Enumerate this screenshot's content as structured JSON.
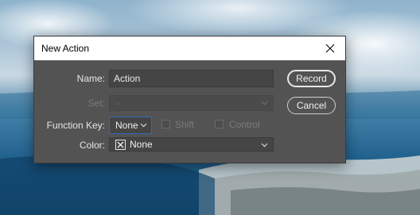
{
  "dialog": {
    "title": "New Action",
    "close_icon": "close-icon"
  },
  "form": {
    "name_label": "Name:",
    "name_value": "Action",
    "set_label": "Set:",
    "set_value": "-",
    "function_key_label": "Function Key:",
    "function_key_value": "None",
    "shift_label": "Shift",
    "control_label": "Control",
    "color_label": "Color:",
    "color_value": "None",
    "color_icon": "no-color-icon"
  },
  "buttons": {
    "record_label": "Record",
    "cancel_label": "Cancel"
  }
}
